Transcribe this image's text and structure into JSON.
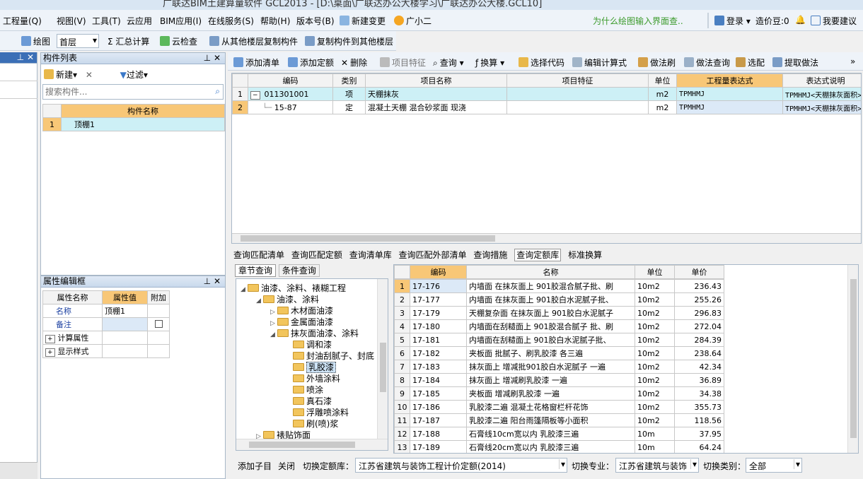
{
  "app": {
    "title": "广联达BIM土建算量软件 GCL2013 - [D:\\桌面\\广联达办公大楼学习\\广联达办公大楼.GCL10]"
  },
  "menu": [
    "工程量(Q)",
    "视图(V)",
    "工具(T)",
    "云应用",
    "BIM应用(I)",
    "在线服务(S)",
    "帮助(H)",
    "版本号(B)",
    "新建变更",
    "广小二"
  ],
  "menu_right": {
    "hint": "为什么绘图输入界面查..",
    "login": "登录",
    "price_bean": "造价豆:0",
    "suggest": "我要建议"
  },
  "toolbar2": {
    "draw": "绘图",
    "floor": "首层",
    "sum": "Σ 汇总计算",
    "cloud_check": "云检查",
    "copy_from": "从其他楼层复制构件",
    "copy_to": "复制构件到其他楼层"
  },
  "component_list": {
    "title": "构件列表",
    "new": "新建",
    "filter": "过滤",
    "search_placeholder": "搜索构件...",
    "col": "构件名称",
    "rows": [
      {
        "n": "1",
        "name": "顶棚1"
      }
    ]
  },
  "props": {
    "title": "属性编辑框",
    "cols": [
      "属性名称",
      "属性值",
      "附加"
    ],
    "rows": [
      {
        "name": "名称",
        "value": "顶棚1"
      },
      {
        "name": "备注",
        "value": ""
      },
      {
        "name": "计算属性",
        "value": ""
      },
      {
        "name": "显示样式",
        "value": ""
      }
    ]
  },
  "main_toolbar": [
    "添加清单",
    "添加定额",
    "删除",
    "项目特征",
    "查询",
    "换算",
    "选择代码",
    "编辑计算式",
    "做法刷",
    "做法查询",
    "选配",
    "提取做法"
  ],
  "main_table": {
    "cols": [
      "编码",
      "类别",
      "项目名称",
      "项目特征",
      "单位",
      "工程量表达式",
      "表达式说明"
    ],
    "rows": [
      {
        "n": "1",
        "code": "011301001",
        "type": "项",
        "name": "天棚抹灰",
        "feature": "",
        "unit": "m2",
        "expr": "TPMHMJ",
        "desc": "TPMHMJ<天棚抹灰面积>"
      },
      {
        "n": "2",
        "code": "15-87",
        "type": "定",
        "name": "混凝土天棚 混合砂浆面 现浇",
        "feature": "",
        "unit": "m2",
        "expr": "TPMHMJ",
        "desc": "TPMHMJ<天棚抹灰面积>"
      }
    ]
  },
  "bottom_tabs": [
    "查询匹配清单",
    "查询匹配定额",
    "查询清单库",
    "查询匹配外部清单",
    "查询措施",
    "查询定额库",
    "标准换算"
  ],
  "sub_tabs": [
    "章节查询",
    "条件查询"
  ],
  "tree": [
    "油漆、涂料、裱糊工程",
    "油漆、涂料",
    "木材面油漆",
    "金属面油漆",
    "抹灰面油漆、涂料",
    "调和漆",
    "封油刮腻子、封底",
    "乳胶漆",
    "外墙涂料",
    "喷涂",
    "真石漆",
    "浮雕喷涂料",
    "刷(喷)浆",
    "裱贴饰面"
  ],
  "quota_table": {
    "cols": [
      "编码",
      "名称",
      "单位",
      "单价"
    ],
    "rows": [
      {
        "n": "1",
        "code": "17-176",
        "name": "内墙面 在抹灰面上 901胶混合腻子批、刷",
        "unit": "10m2",
        "price": "236.43"
      },
      {
        "n": "2",
        "code": "17-177",
        "name": "内墙面 在抹灰面上 901胶白水泥腻子批、",
        "unit": "10m2",
        "price": "255.26"
      },
      {
        "n": "3",
        "code": "17-179",
        "name": "天棚复杂面 在抹灰面上 901胶白水泥腻子",
        "unit": "10m2",
        "price": "296.83"
      },
      {
        "n": "4",
        "code": "17-180",
        "name": "内墙面在刮糙面上 901胶混合腻子 批、刷",
        "unit": "10m2",
        "price": "272.04"
      },
      {
        "n": "5",
        "code": "17-181",
        "name": "内墙面在刮糙面上 901胶白水泥腻子批、",
        "unit": "10m2",
        "price": "284.39"
      },
      {
        "n": "6",
        "code": "17-182",
        "name": "夹板面 批腻子、刷乳胶漆 各三遍",
        "unit": "10m2",
        "price": "238.64"
      },
      {
        "n": "7",
        "code": "17-183",
        "name": "抹灰面上 增减批901胶白水泥腻子 一遍",
        "unit": "10m2",
        "price": "42.34"
      },
      {
        "n": "8",
        "code": "17-184",
        "name": "抹灰面上 增减刷乳胶漆 一遍",
        "unit": "10m2",
        "price": "36.89"
      },
      {
        "n": "9",
        "code": "17-185",
        "name": "夹板面 增减刷乳胶漆 一遍",
        "unit": "10m2",
        "price": "34.38"
      },
      {
        "n": "10",
        "code": "17-186",
        "name": "乳胶漆二遍 混凝土花格窗栏杆花饰",
        "unit": "10m2",
        "price": "355.73"
      },
      {
        "n": "11",
        "code": "17-187",
        "name": "乳胶漆二遍 阳台雨篷隔板等小面积",
        "unit": "10m2",
        "price": "118.56"
      },
      {
        "n": "12",
        "code": "17-188",
        "name": "石膏线10cm宽以内 乳胶漆三遍",
        "unit": "10m",
        "price": "37.95"
      },
      {
        "n": "13",
        "code": "17-189",
        "name": "石膏线20cm宽以内 乳胶漆三遍",
        "unit": "10m",
        "price": "64.24"
      }
    ]
  },
  "status_bar": {
    "add_child": "添加子目",
    "close": "关闭",
    "switch_lib_label": "切换定额库：",
    "lib": "江苏省建筑与装饰工程计价定额(2014)",
    "switch_major_label": "切换专业：",
    "major": "江苏省建筑与装饰",
    "switch_cat_label": "切换类别：",
    "cat": "全部"
  }
}
